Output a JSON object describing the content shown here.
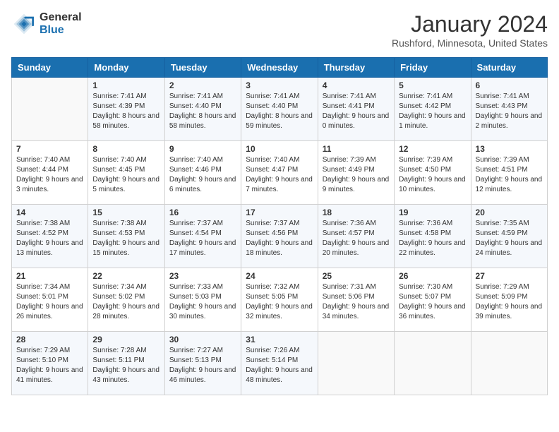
{
  "header": {
    "logo_general": "General",
    "logo_blue": "Blue",
    "month_title": "January 2024",
    "location": "Rushford, Minnesota, United States"
  },
  "days_of_week": [
    "Sunday",
    "Monday",
    "Tuesday",
    "Wednesday",
    "Thursday",
    "Friday",
    "Saturday"
  ],
  "weeks": [
    [
      {
        "day": "",
        "sunrise": "",
        "sunset": "",
        "daylight": "",
        "empty": true
      },
      {
        "day": "1",
        "sunrise": "Sunrise: 7:41 AM",
        "sunset": "Sunset: 4:39 PM",
        "daylight": "Daylight: 8 hours and 58 minutes.",
        "empty": false
      },
      {
        "day": "2",
        "sunrise": "Sunrise: 7:41 AM",
        "sunset": "Sunset: 4:40 PM",
        "daylight": "Daylight: 8 hours and 58 minutes.",
        "empty": false
      },
      {
        "day": "3",
        "sunrise": "Sunrise: 7:41 AM",
        "sunset": "Sunset: 4:40 PM",
        "daylight": "Daylight: 8 hours and 59 minutes.",
        "empty": false
      },
      {
        "day": "4",
        "sunrise": "Sunrise: 7:41 AM",
        "sunset": "Sunset: 4:41 PM",
        "daylight": "Daylight: 9 hours and 0 minutes.",
        "empty": false
      },
      {
        "day": "5",
        "sunrise": "Sunrise: 7:41 AM",
        "sunset": "Sunset: 4:42 PM",
        "daylight": "Daylight: 9 hours and 1 minute.",
        "empty": false
      },
      {
        "day": "6",
        "sunrise": "Sunrise: 7:41 AM",
        "sunset": "Sunset: 4:43 PM",
        "daylight": "Daylight: 9 hours and 2 minutes.",
        "empty": false
      }
    ],
    [
      {
        "day": "7",
        "sunrise": "Sunrise: 7:40 AM",
        "sunset": "Sunset: 4:44 PM",
        "daylight": "Daylight: 9 hours and 3 minutes.",
        "empty": false
      },
      {
        "day": "8",
        "sunrise": "Sunrise: 7:40 AM",
        "sunset": "Sunset: 4:45 PM",
        "daylight": "Daylight: 9 hours and 5 minutes.",
        "empty": false
      },
      {
        "day": "9",
        "sunrise": "Sunrise: 7:40 AM",
        "sunset": "Sunset: 4:46 PM",
        "daylight": "Daylight: 9 hours and 6 minutes.",
        "empty": false
      },
      {
        "day": "10",
        "sunrise": "Sunrise: 7:40 AM",
        "sunset": "Sunset: 4:47 PM",
        "daylight": "Daylight: 9 hours and 7 minutes.",
        "empty": false
      },
      {
        "day": "11",
        "sunrise": "Sunrise: 7:39 AM",
        "sunset": "Sunset: 4:49 PM",
        "daylight": "Daylight: 9 hours and 9 minutes.",
        "empty": false
      },
      {
        "day": "12",
        "sunrise": "Sunrise: 7:39 AM",
        "sunset": "Sunset: 4:50 PM",
        "daylight": "Daylight: 9 hours and 10 minutes.",
        "empty": false
      },
      {
        "day": "13",
        "sunrise": "Sunrise: 7:39 AM",
        "sunset": "Sunset: 4:51 PM",
        "daylight": "Daylight: 9 hours and 12 minutes.",
        "empty": false
      }
    ],
    [
      {
        "day": "14",
        "sunrise": "Sunrise: 7:38 AM",
        "sunset": "Sunset: 4:52 PM",
        "daylight": "Daylight: 9 hours and 13 minutes.",
        "empty": false
      },
      {
        "day": "15",
        "sunrise": "Sunrise: 7:38 AM",
        "sunset": "Sunset: 4:53 PM",
        "daylight": "Daylight: 9 hours and 15 minutes.",
        "empty": false
      },
      {
        "day": "16",
        "sunrise": "Sunrise: 7:37 AM",
        "sunset": "Sunset: 4:54 PM",
        "daylight": "Daylight: 9 hours and 17 minutes.",
        "empty": false
      },
      {
        "day": "17",
        "sunrise": "Sunrise: 7:37 AM",
        "sunset": "Sunset: 4:56 PM",
        "daylight": "Daylight: 9 hours and 18 minutes.",
        "empty": false
      },
      {
        "day": "18",
        "sunrise": "Sunrise: 7:36 AM",
        "sunset": "Sunset: 4:57 PM",
        "daylight": "Daylight: 9 hours and 20 minutes.",
        "empty": false
      },
      {
        "day": "19",
        "sunrise": "Sunrise: 7:36 AM",
        "sunset": "Sunset: 4:58 PM",
        "daylight": "Daylight: 9 hours and 22 minutes.",
        "empty": false
      },
      {
        "day": "20",
        "sunrise": "Sunrise: 7:35 AM",
        "sunset": "Sunset: 4:59 PM",
        "daylight": "Daylight: 9 hours and 24 minutes.",
        "empty": false
      }
    ],
    [
      {
        "day": "21",
        "sunrise": "Sunrise: 7:34 AM",
        "sunset": "Sunset: 5:01 PM",
        "daylight": "Daylight: 9 hours and 26 minutes.",
        "empty": false
      },
      {
        "day": "22",
        "sunrise": "Sunrise: 7:34 AM",
        "sunset": "Sunset: 5:02 PM",
        "daylight": "Daylight: 9 hours and 28 minutes.",
        "empty": false
      },
      {
        "day": "23",
        "sunrise": "Sunrise: 7:33 AM",
        "sunset": "Sunset: 5:03 PM",
        "daylight": "Daylight: 9 hours and 30 minutes.",
        "empty": false
      },
      {
        "day": "24",
        "sunrise": "Sunrise: 7:32 AM",
        "sunset": "Sunset: 5:05 PM",
        "daylight": "Daylight: 9 hours and 32 minutes.",
        "empty": false
      },
      {
        "day": "25",
        "sunrise": "Sunrise: 7:31 AM",
        "sunset": "Sunset: 5:06 PM",
        "daylight": "Daylight: 9 hours and 34 minutes.",
        "empty": false
      },
      {
        "day": "26",
        "sunrise": "Sunrise: 7:30 AM",
        "sunset": "Sunset: 5:07 PM",
        "daylight": "Daylight: 9 hours and 36 minutes.",
        "empty": false
      },
      {
        "day": "27",
        "sunrise": "Sunrise: 7:29 AM",
        "sunset": "Sunset: 5:09 PM",
        "daylight": "Daylight: 9 hours and 39 minutes.",
        "empty": false
      }
    ],
    [
      {
        "day": "28",
        "sunrise": "Sunrise: 7:29 AM",
        "sunset": "Sunset: 5:10 PM",
        "daylight": "Daylight: 9 hours and 41 minutes.",
        "empty": false
      },
      {
        "day": "29",
        "sunrise": "Sunrise: 7:28 AM",
        "sunset": "Sunset: 5:11 PM",
        "daylight": "Daylight: 9 hours and 43 minutes.",
        "empty": false
      },
      {
        "day": "30",
        "sunrise": "Sunrise: 7:27 AM",
        "sunset": "Sunset: 5:13 PM",
        "daylight": "Daylight: 9 hours and 46 minutes.",
        "empty": false
      },
      {
        "day": "31",
        "sunrise": "Sunrise: 7:26 AM",
        "sunset": "Sunset: 5:14 PM",
        "daylight": "Daylight: 9 hours and 48 minutes.",
        "empty": false
      },
      {
        "day": "",
        "sunrise": "",
        "sunset": "",
        "daylight": "",
        "empty": true
      },
      {
        "day": "",
        "sunrise": "",
        "sunset": "",
        "daylight": "",
        "empty": true
      },
      {
        "day": "",
        "sunrise": "",
        "sunset": "",
        "daylight": "",
        "empty": true
      }
    ]
  ]
}
